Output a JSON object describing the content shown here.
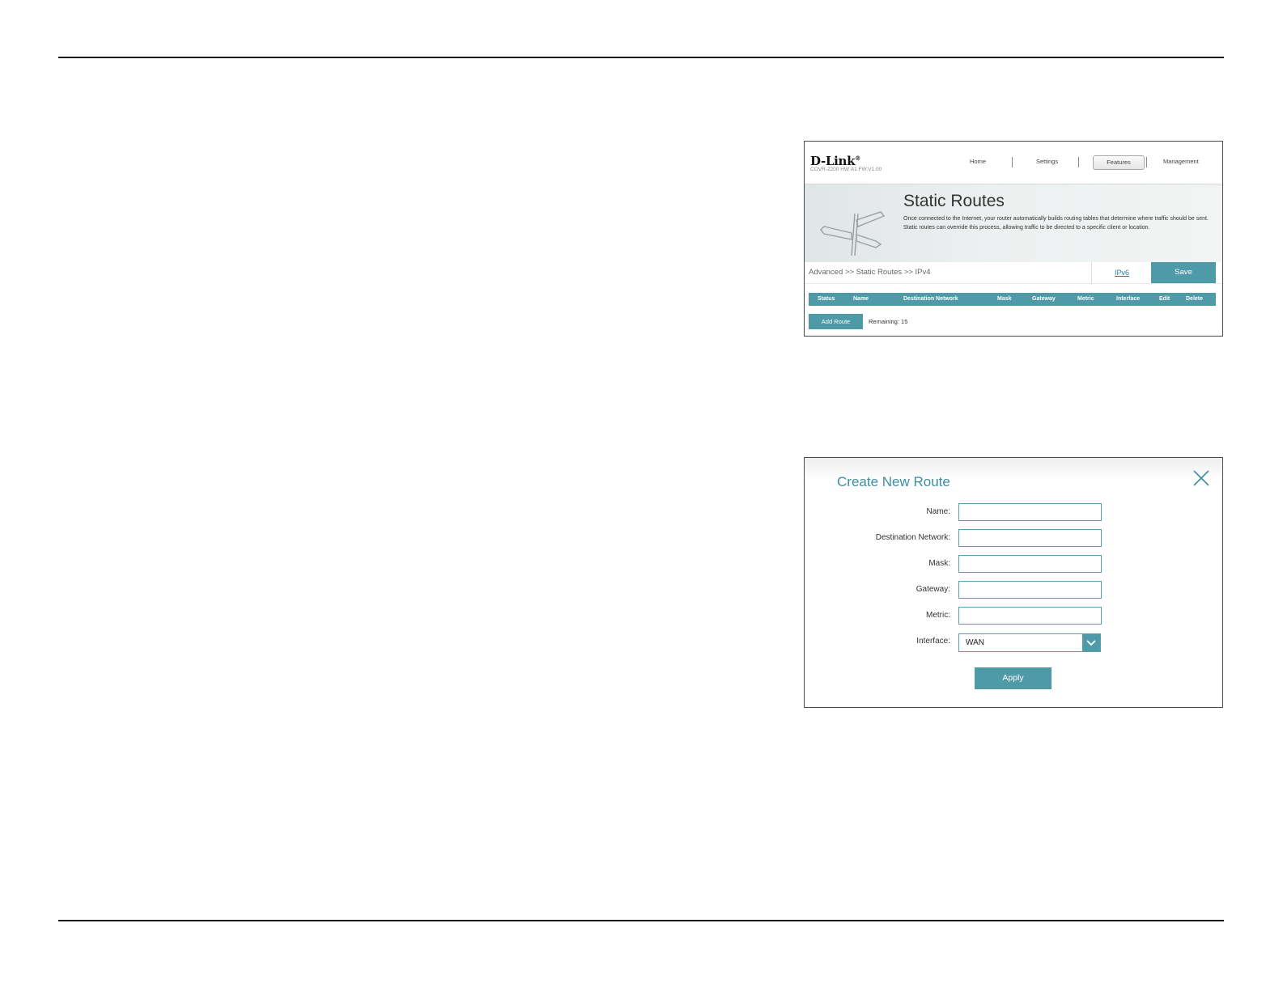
{
  "screenshot1": {
    "brand": "D-Link",
    "model_info": "COVR-2200 HW:A1 FW:V1.00",
    "nav": {
      "home": "Home",
      "settings": "Settings",
      "features": "Features",
      "management": "Management"
    },
    "title": "Static Routes",
    "description": "Once connected to the Internet, your router automatically builds routing tables that determine where traffic should be sent. Static routes can override this process, allowing traffic to be directed to a specific client or location.",
    "breadcrumb": "Advanced >> Static Routes >> IPv4",
    "ipv6_link": "IPv6",
    "save_label": "Save",
    "table_headers": [
      "Status",
      "Name",
      "Destination Network",
      "Mask",
      "Gateway",
      "Metric",
      "Interface",
      "Edit",
      "Delete"
    ],
    "add_route_label": "Add Route",
    "remaining": "Remaining: 15"
  },
  "screenshot2": {
    "title": "Create New Route",
    "fields": {
      "name_label": "Name:",
      "destination_label": "Destination Network:",
      "mask_label": "Mask:",
      "gateway_label": "Gateway:",
      "metric_label": "Metric:",
      "interface_label": "Interface:"
    },
    "interface_value": "WAN",
    "apply_label": "Apply"
  },
  "colors": {
    "accent": "#4e9aa7",
    "title_teal": "#3c8ea0",
    "link_blue": "#2a7db4"
  }
}
